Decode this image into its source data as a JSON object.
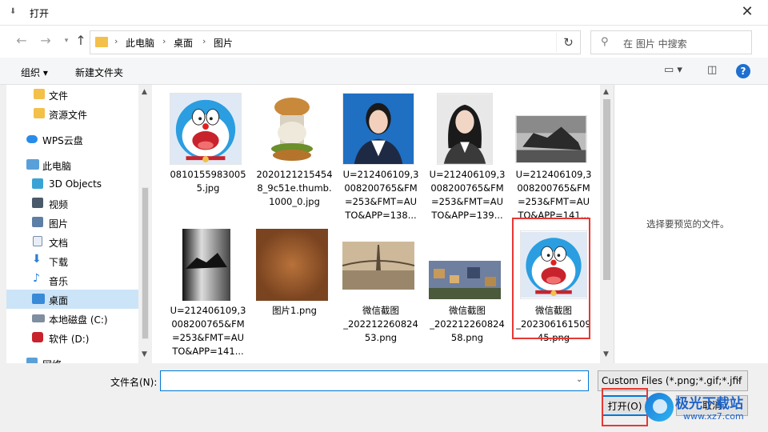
{
  "window": {
    "title": "打开",
    "close": "✕"
  },
  "nav": {
    "back": "←",
    "forward": "→",
    "up": "↑",
    "refresh": "↻"
  },
  "breadcrumb": [
    "此电脑",
    "桌面",
    "图片"
  ],
  "search": {
    "placeholder": "在 图片 中搜索"
  },
  "toolbar": {
    "organize": "组织 ▾",
    "new_folder": "新建文件夹",
    "help": "?"
  },
  "sidebar": {
    "items": [
      {
        "label": "文件",
        "icon": "folder-icon"
      },
      {
        "label": "资源文件",
        "icon": "folder-icon"
      },
      {
        "label": "WPS云盘",
        "icon": "cloud-icon"
      },
      {
        "label": "此电脑",
        "icon": "computer-icon"
      },
      {
        "label": "3D Objects",
        "icon": "3d-objects-icon"
      },
      {
        "label": "视频",
        "icon": "video-icon"
      },
      {
        "label": "图片",
        "icon": "pictures-icon"
      },
      {
        "label": "文档",
        "icon": "document-icon"
      },
      {
        "label": "下载",
        "icon": "download-icon"
      },
      {
        "label": "音乐",
        "icon": "music-icon"
      },
      {
        "label": "桌面",
        "icon": "desktop-icon",
        "selected": true
      },
      {
        "label": "本地磁盘 (C:)",
        "icon": "disk-icon"
      },
      {
        "label": "软件 (D:)",
        "icon": "disk-icon"
      },
      {
        "label": "网络",
        "icon": "network-icon"
      }
    ]
  },
  "files": [
    {
      "name": "0810155983005\n5.jpg",
      "thumb": "doraemon"
    },
    {
      "name": "2020121215454\n8_9c51e.thumb.\n1000_0.jpg",
      "thumb": "burger"
    },
    {
      "name": "U=212406109,3\n008200765&FM\n=253&FMT=AU\nTO&APP=138...",
      "thumb": "portrait-blue"
    },
    {
      "name": "U=212406109,3\n008200765&FM\n=253&FMT=AU\nTO&APP=139...",
      "thumb": "portrait-white"
    },
    {
      "name": "U=212406109,3\n008200765&FM\n=253&FMT=AU\nTO&APP=141...",
      "thumb": "rock-landscape"
    },
    {
      "name": "U=212406109,3\n008200765&FM\n=253&FMT=AU\nTO&APP=141...",
      "thumb": "rock-bw"
    },
    {
      "name": "图片1.png",
      "thumb": "leather"
    },
    {
      "name": "微信截图\n_202212260824\n53.png",
      "thumb": "bridge"
    },
    {
      "name": "微信截图\n_202212260824\n58.png",
      "thumb": "city"
    },
    {
      "name": "微信截图\n_202306161509\n45.png",
      "thumb": "doraemon"
    }
  ],
  "preview": {
    "message": "选择要预览的文件。"
  },
  "footer": {
    "filename_label": "文件名(N):",
    "filename_value": "",
    "filter": "Custom Files (*.png;*.gif;*.jfif",
    "open": "打开(O)",
    "cancel": "取消"
  },
  "watermark": {
    "title": "极光下载站",
    "url": "www.xz7.com"
  }
}
